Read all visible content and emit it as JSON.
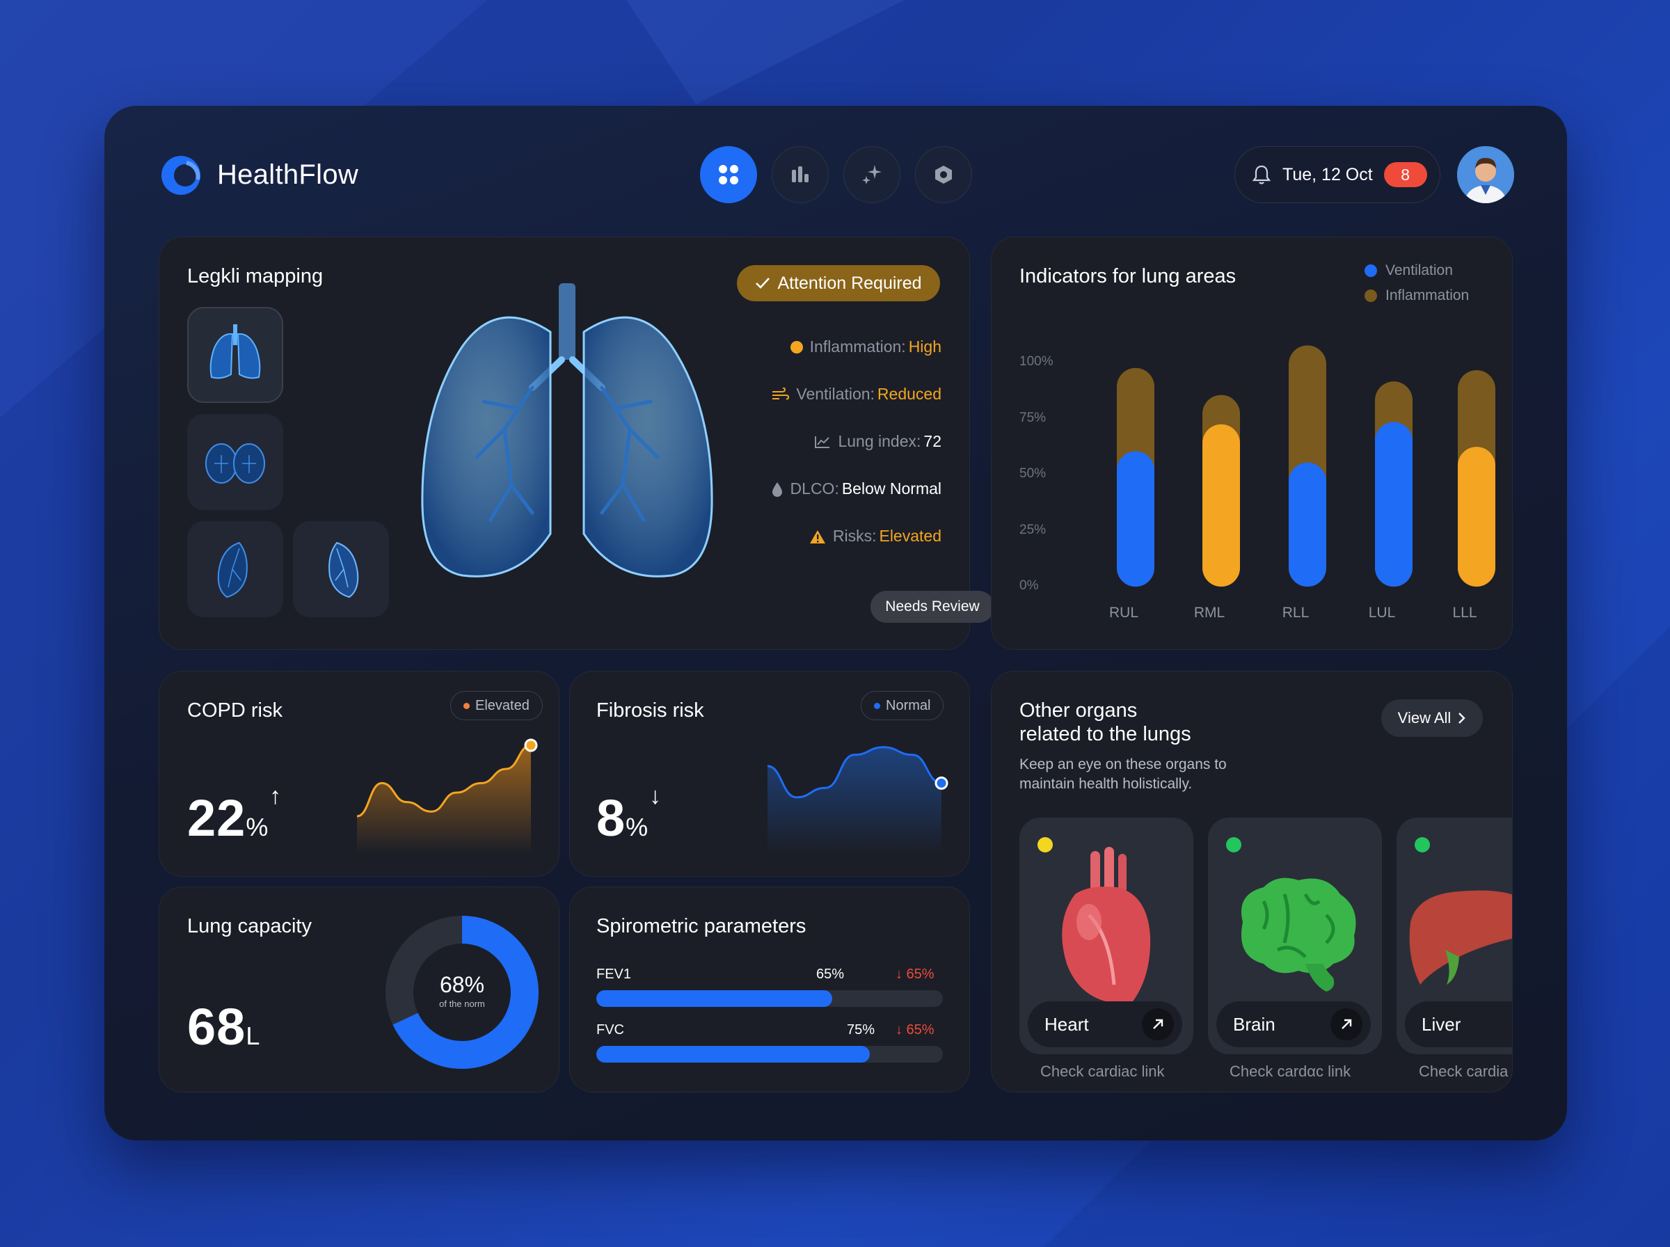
{
  "app": {
    "name": "HealthFlow"
  },
  "header": {
    "nav": [
      "dashboard-icon",
      "analytics-icon",
      "ai-sparkle-icon",
      "settings-icon"
    ],
    "date": "Tue, 12 Oct",
    "notification_count": "8"
  },
  "lung_mapping": {
    "title": "Legkli mapping",
    "status": "Attention Required",
    "stats": [
      {
        "label": "Inflammation:",
        "value": "High",
        "color": "#f4a521"
      },
      {
        "label": "Ventilation:",
        "value": "Reduced",
        "color": "#f4a521"
      },
      {
        "label": "Lung index:",
        "value": "72",
        "color": "#ffffff"
      },
      {
        "label": "DLCO:",
        "value": "Below Normal",
        "color": "#ffffff"
      },
      {
        "label": "Risks:",
        "value": "Elevated",
        "color": "#f4a521"
      }
    ],
    "review_label": "Needs Review"
  },
  "indicators": {
    "title": "Indicators for lung areas",
    "legend": [
      "Ventilation",
      "Inflammation"
    ],
    "colors": {
      "ventilation": "#1f6cf6",
      "inflammation": "#f4a521",
      "background_bar": "#7a5a1e"
    }
  },
  "chart_data": {
    "type": "bar",
    "title": "Indicators for lung areas",
    "categories": [
      "RUL",
      "RML",
      "RLL",
      "LUL",
      "LLL"
    ],
    "yticks": [
      "100%",
      "75%",
      "50%",
      "25%",
      "0%"
    ],
    "ylim": [
      0,
      100
    ],
    "legend_position": "top-right",
    "series": [
      {
        "name": "Ventilation",
        "values": [
          60,
          72,
          55,
          73,
          62
        ]
      },
      {
        "name": "Inflammation",
        "values": [
          97,
          85,
          107,
          91,
          96
        ]
      }
    ],
    "front_color": [
      "#1f6cf6",
      "#f4a521",
      "#1f6cf6",
      "#1f6cf6",
      "#f4a521"
    ]
  },
  "copd": {
    "title": "COPD risk",
    "status": "Elevated",
    "value": "22",
    "unit": "%",
    "trend": "↑",
    "sparkline": [
      0.25,
      0.6,
      0.4,
      0.3,
      0.5,
      0.6,
      0.75,
      1.0
    ]
  },
  "fibrosis": {
    "title": "Fibrosis risk",
    "status": "Normal",
    "value": "8",
    "unit": "%",
    "trend": "↓",
    "sparkline": [
      0.78,
      0.45,
      0.55,
      0.9,
      0.98,
      0.9,
      0.6
    ]
  },
  "capacity": {
    "title": "Lung capacity",
    "value": "68",
    "unit": "L",
    "percent": 68,
    "percent_label": "68%",
    "sub": "of the norm"
  },
  "spirometry": {
    "title": "Spirometric parameters",
    "rows": [
      {
        "name": "FEV1",
        "value": "65%",
        "level": 0.68,
        "delta": "↓ 65%"
      },
      {
        "name": "FVC",
        "value": "75%",
        "level": 0.79,
        "delta": "↓ 65%"
      }
    ]
  },
  "organs": {
    "title_line1": "Other organs",
    "title_line2": "related to the lungs",
    "desc_line1": "Keep an eye on these organs to",
    "desc_line2": "maintain health holistically.",
    "view_all": "View All",
    "items": [
      {
        "name": "Heart",
        "caption": "Check cardiac link",
        "status_color": "#f2d621"
      },
      {
        "name": "Brain",
        "caption": "Check cardαc link",
        "status_color": "#22c55e"
      },
      {
        "name": "Liver",
        "caption": "Check cardia",
        "status_color": "#22c55e"
      }
    ]
  }
}
